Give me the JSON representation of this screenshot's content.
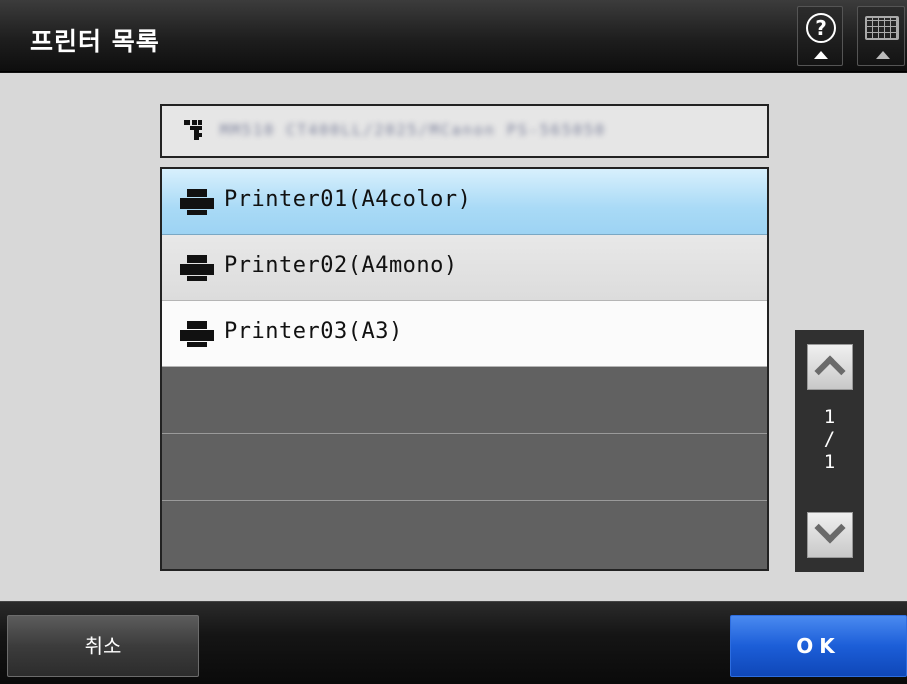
{
  "header": {
    "title": "프린터 목록",
    "help_glyph": "?",
    "help_icon": "help-icon",
    "keyboard_icon": "keyboard-icon"
  },
  "device": {
    "icon": "network-tree-icon",
    "name": "MM510 CT400LL/2025/MCanon PS-565050"
  },
  "printers": [
    {
      "label": "Printer01(A4color)",
      "icon": "printer-icon",
      "selected": true
    },
    {
      "label": "Printer02(A4mono)",
      "icon": "printer-icon",
      "selected": false
    },
    {
      "label": "Printer03(A3)",
      "icon": "printer-icon",
      "selected": false
    }
  ],
  "pager": {
    "current": "1",
    "separator": "/",
    "total": "1"
  },
  "footer": {
    "cancel_label": "취소",
    "ok_label": "OK"
  },
  "colors": {
    "selected_row": "#a9daf6",
    "ok_button": "#1c5ed8",
    "background": "#d8d8d8"
  }
}
